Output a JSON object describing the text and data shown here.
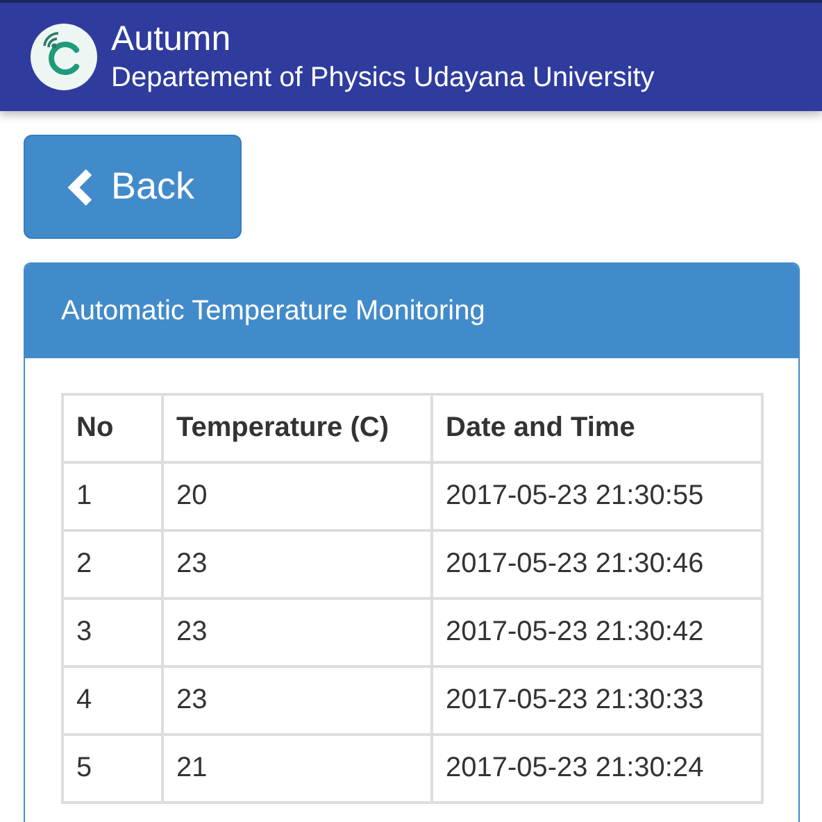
{
  "app_bar": {
    "title": "Autumn",
    "subtitle": "Departement of Physics Udayana University"
  },
  "back_button": {
    "label": "Back"
  },
  "panel": {
    "title": "Automatic Temperature Monitoring",
    "table": {
      "columns": [
        "No",
        "Temperature (C)",
        "Date and Time"
      ],
      "rows": [
        [
          "1",
          "20",
          "2017-05-23 21:30:55"
        ],
        [
          "2",
          "23",
          "2017-05-23 21:30:46"
        ],
        [
          "3",
          "23",
          "2017-05-23 21:30:42"
        ],
        [
          "4",
          "23",
          "2017-05-23 21:30:33"
        ],
        [
          "5",
          "21",
          "2017-05-23 21:30:24"
        ]
      ]
    }
  }
}
